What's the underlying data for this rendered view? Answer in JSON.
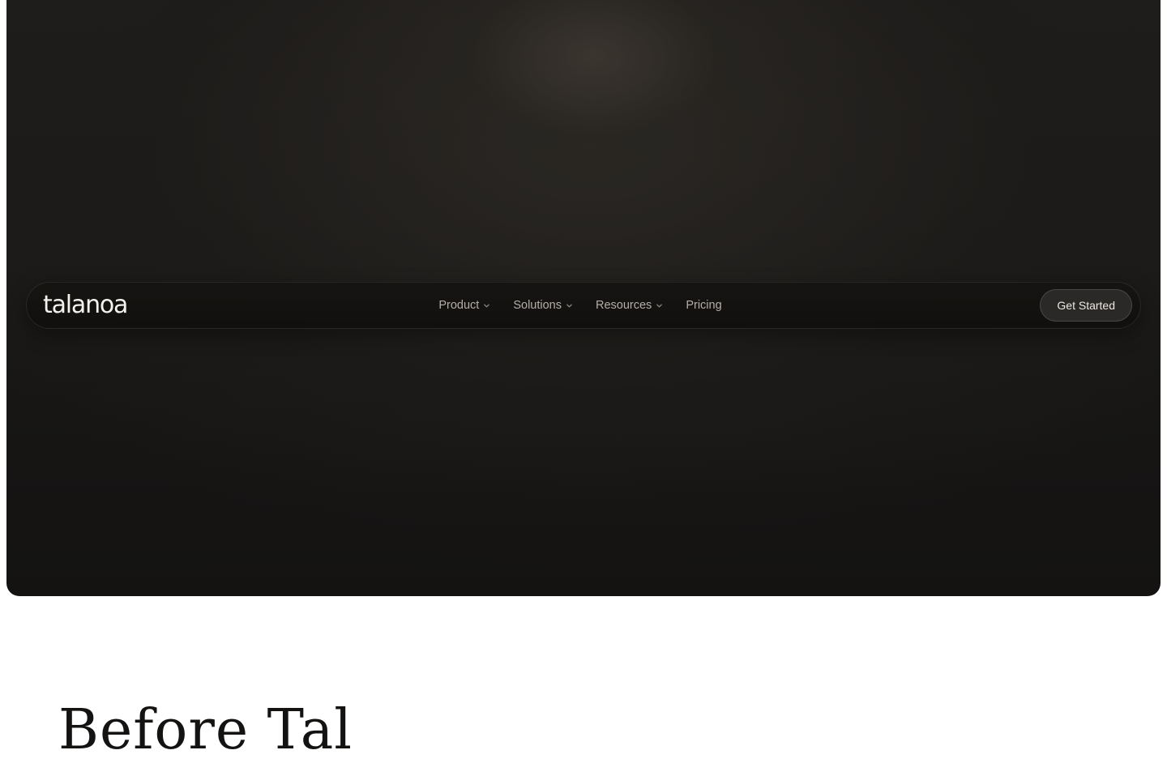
{
  "brand": {
    "logo_text": "talanoa"
  },
  "nav": {
    "items": [
      {
        "label": "Product",
        "has_dropdown": true
      },
      {
        "label": "Solutions",
        "has_dropdown": true
      },
      {
        "label": "Resources",
        "has_dropdown": true
      },
      {
        "label": "Pricing",
        "has_dropdown": false
      }
    ],
    "cta_label": "Get Started"
  },
  "next_section": {
    "heading_partial": "Before Tal"
  },
  "colors": {
    "hero_background": "#1b1a18",
    "nav_text": "#b3aea7",
    "cta_background": "#2b2927",
    "logo": "#f4f2ee",
    "page_background": "#ffffff"
  },
  "icons": {
    "dropdown": "chevron-down-icon"
  }
}
